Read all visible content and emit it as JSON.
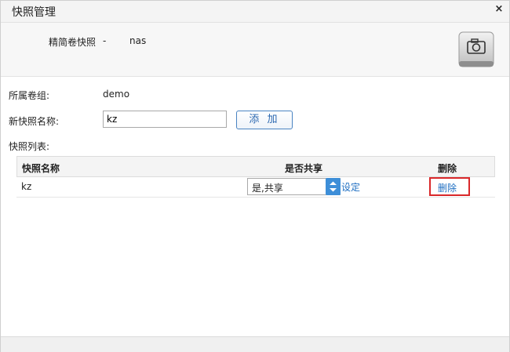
{
  "dialog": {
    "title": "快照管理",
    "close_symbol": "×"
  },
  "header": {
    "label": "精简卷快照",
    "dash": "-",
    "value": "nas",
    "icon": "camera-icon"
  },
  "form": {
    "volume_group_label": "所属卷组:",
    "volume_group_value": "demo",
    "new_snapshot_label": "新快照名称:",
    "new_snapshot_value": "kz",
    "add_button": "添 加",
    "list_label": "快照列表:"
  },
  "table": {
    "columns": [
      "快照名称",
      "是否共享",
      "删除"
    ],
    "rows": [
      {
        "name": "kz",
        "share_selected": "是,共享",
        "set_link": "设定",
        "delete_link": "删除"
      }
    ]
  },
  "colors": {
    "link": "#1f6fc2",
    "accent": "#3d8ed8",
    "highlight_border": "#d9282a"
  }
}
